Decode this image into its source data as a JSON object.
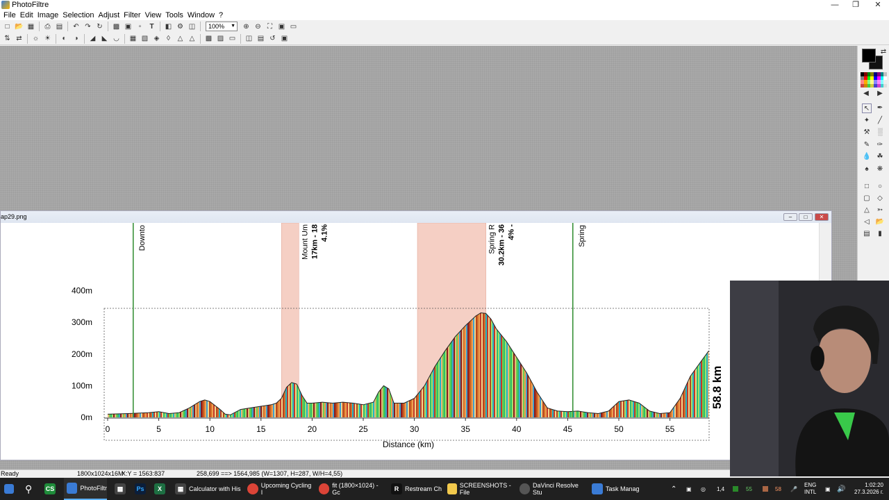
{
  "app": {
    "title": "PhotoFiltre"
  },
  "menu": [
    "File",
    "Edit",
    "Image",
    "Selection",
    "Adjust",
    "Filter",
    "View",
    "Tools",
    "Window",
    "?"
  ],
  "toolbar": {
    "zoom": "100%"
  },
  "image_window": {
    "title": "ap29.png"
  },
  "chart_data": {
    "type": "area",
    "xlabel": "Distance (km)",
    "ylabel": "",
    "xlim": [
      0,
      59
    ],
    "ylim": [
      0,
      400
    ],
    "x_ticks": [
      "0",
      "5",
      "10",
      "15",
      "20",
      "25",
      "30",
      "35",
      "40",
      "45",
      "50",
      "55"
    ],
    "y_ticks": [
      "0m",
      "100m",
      "200m",
      "300m",
      "400m"
    ],
    "total_label": "58.8 km",
    "profile": {
      "x": [
        0,
        2,
        4,
        5,
        6,
        7,
        8,
        9,
        9.5,
        10,
        11,
        11.5,
        12,
        13,
        14,
        15,
        16,
        16.5,
        17,
        17.5,
        18,
        18.5,
        19,
        19.5,
        20,
        21,
        22,
        23,
        24,
        25,
        26,
        26.5,
        27,
        27.5,
        28,
        29,
        30,
        31,
        32,
        33,
        34,
        35,
        36,
        36.5,
        37,
        37.5,
        38,
        39,
        40,
        41,
        42,
        43,
        44,
        45,
        46,
        47,
        48,
        49,
        50,
        51,
        52,
        53,
        54,
        55,
        56,
        57,
        58,
        58.8
      ],
      "y": [
        10,
        12,
        15,
        18,
        12,
        15,
        30,
        50,
        55,
        50,
        25,
        10,
        8,
        25,
        30,
        35,
        40,
        45,
        60,
        95,
        110,
        105,
        70,
        45,
        45,
        48,
        45,
        48,
        45,
        40,
        48,
        80,
        100,
        90,
        45,
        45,
        60,
        100,
        160,
        210,
        255,
        290,
        320,
        330,
        328,
        310,
        280,
        240,
        190,
        140,
        80,
        30,
        20,
        18,
        20,
        15,
        12,
        20,
        50,
        55,
        45,
        20,
        12,
        15,
        60,
        130,
        175,
        210
      ]
    },
    "markers": [
      {
        "km": 2.5,
        "label": "Downto",
        "color": "#2e8b2e"
      },
      {
        "km": 45.5,
        "label": "Spring",
        "color": "#2e8b2e"
      }
    ],
    "climbs": [
      {
        "start_km": 17,
        "end_km": 18.7,
        "label1": "Mount Um",
        "label2": "17km - 18",
        "label3": "4.1%"
      },
      {
        "start_km": 30.3,
        "end_km": 37,
        "label1": "Spring R",
        "label2": "30.2km - 36",
        "label3": "4% -"
      }
    ]
  },
  "status": {
    "ready": "Ready",
    "size": "1800x1024x16M",
    "xy": "X:Y = 1563:837",
    "selection": "258,699 ==> 1564,985 (W=1307, H=287, W/H=4,55)"
  },
  "taskbar": {
    "items": [
      {
        "label": "PhotoFiltr",
        "icon": "photofiltre-icon",
        "color": "#3a7bd5"
      },
      {
        "label": "Calculator with His",
        "icon": "calculator-icon",
        "color": "#444"
      },
      {
        "label": "Upcoming Cycling I",
        "icon": "chrome-icon",
        "color": "#db4437"
      },
      {
        "label": "fit (1800×1024) - Gc",
        "icon": "chrome-icon",
        "color": "#db4437"
      },
      {
        "label": "Restream Ch",
        "icon": "restream-icon",
        "color": "#111"
      },
      {
        "label": "SCREENSHOTS - File",
        "icon": "folder-icon",
        "color": "#f2c94c"
      },
      {
        "label": "DaVinci Resolve Stu",
        "icon": "davinci-icon",
        "color": "#555"
      },
      {
        "label": "Task Manag",
        "icon": "task-manager-icon",
        "color": "#3a7bd5"
      }
    ],
    "tray": {
      "lang1": "ENG",
      "lang2": "INTL",
      "time": "1:02:20",
      "date": "27.3.2026 г.",
      "n1": "1,4",
      "n2": "55",
      "n3": "58"
    }
  }
}
